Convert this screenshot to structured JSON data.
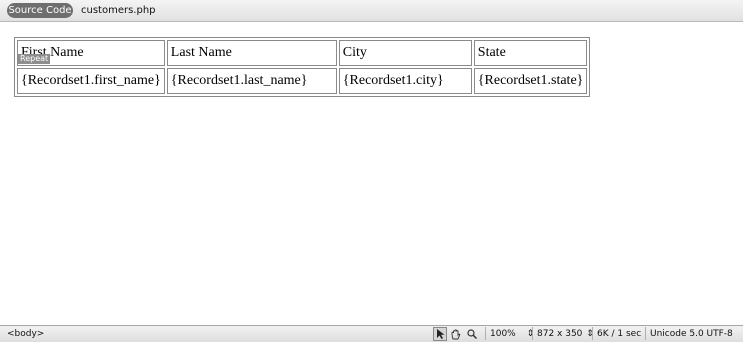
{
  "toolbar": {
    "source_code_label": "Source Code",
    "file_name": "customers.php"
  },
  "table": {
    "headers": [
      "First Name",
      "Last Name",
      "City",
      "State"
    ],
    "row": [
      "{Recordset1.first_name}",
      "{Recordset1.last_name}",
      "{Recordset1.city}",
      "{Recordset1.state}"
    ],
    "repeat_label": "Repeat"
  },
  "status": {
    "tag": "<body>",
    "zoom": "100%",
    "window_size": "872 x 350",
    "download": "6K / 1 sec",
    "encoding": "Unicode 5.0 UTF-8",
    "tools": [
      "pointer-icon",
      "hand-icon",
      "zoom-icon"
    ]
  }
}
